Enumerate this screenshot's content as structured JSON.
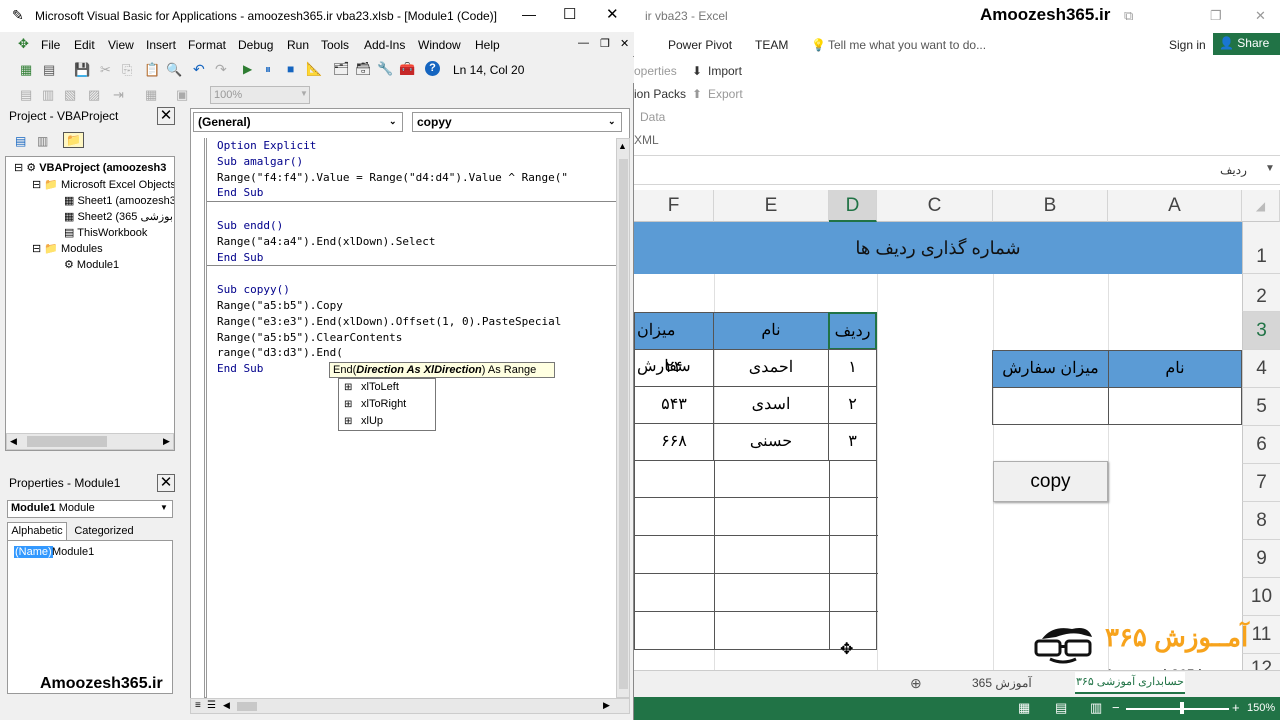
{
  "excel": {
    "title": "ir vba23 - Excel",
    "brand": "Amoozesh365.ir",
    "tabs": [
      "Power Pivot",
      "TEAM"
    ],
    "tell_me": "Tell me what you want to do...",
    "sign_in": "Sign in",
    "share": "Share",
    "ribbon": {
      "properties": "operties",
      "import": "Import",
      "packs": "ion Packs",
      "export": "Export",
      "data": "Data",
      "xml": "XML"
    },
    "name_box": "ردیف",
    "columns": [
      "F",
      "E",
      "D",
      "C",
      "B",
      "A"
    ],
    "rows": [
      "1",
      "2",
      "3",
      "4",
      "5",
      "6",
      "7",
      "8",
      "9",
      "10",
      "11",
      "12"
    ],
    "header_title": "شماره گذاری ردیف ها",
    "table1": {
      "headers": [
        "میزان سفارش",
        "نام",
        "ردیف"
      ],
      "rows": [
        {
          "amount": "۲۴",
          "name": "احمدی",
          "id": "۱"
        },
        {
          "amount": "۵۴۳",
          "name": "اسدی",
          "id": "۲"
        },
        {
          "amount": "۶۶۸",
          "name": "حسنی",
          "id": "۳"
        }
      ]
    },
    "table2": {
      "headers": [
        "میزان سفارش",
        "نام"
      ]
    },
    "copy_button": "copy",
    "sheet_tab": "365 آموزش",
    "sheet_tab_partial": "۳۶۵ حسابداری آموزشی",
    "zoom": "150%",
    "logo_text": "آمــوزش ۳۶۵",
    "logo_url": "Amoozesh365.ir"
  },
  "vba": {
    "title": "Microsoft Visual Basic for Applications - amoozesh365.ir vba23.xlsb - [Module1 (Code)]",
    "menus": [
      "File",
      "Edit",
      "View",
      "Insert",
      "Format",
      "Debug",
      "Run",
      "Tools",
      "Add-Ins",
      "Window",
      "Help"
    ],
    "position": "Ln 14, Col 20",
    "zoom": "100%",
    "project_title": "Project - VBAProject",
    "tree": [
      {
        "label": "VBAProject (amoozesh3",
        "level": 0,
        "bold": true
      },
      {
        "label": "Microsoft Excel Objects",
        "level": 1
      },
      {
        "label": "Sheet1 (amoozesh3",
        "level": 2
      },
      {
        "label": "Sheet2 (365 بوزشی",
        "level": 2
      },
      {
        "label": "ThisWorkbook",
        "level": 2
      },
      {
        "label": "Modules",
        "level": 1
      },
      {
        "label": "Module1",
        "level": 2
      }
    ],
    "properties_title": "Properties - Module1",
    "props_object": "Module1",
    "props_type": "Module",
    "props_tabs": [
      "Alphabetic",
      "Categorized"
    ],
    "props_name_key": "(Name)",
    "props_name_val": "Module1",
    "object_dropdown": "(General)",
    "proc_dropdown": "copyy",
    "code": [
      [
        "kw",
        "Option Explicit"
      ],
      [
        "kw",
        "Sub amalgar()"
      ],
      [
        "",
        "Range(\"f4:f4\").Value = Range(\"d4:d4\").Value ^ Range(\""
      ],
      [
        "kw",
        "End Sub"
      ],
      [
        "sep",
        ""
      ],
      [
        "",
        ""
      ],
      [
        "kw",
        "Sub endd()"
      ],
      [
        "",
        "Range(\"a4:a4\").End(xlDown).Select"
      ],
      [
        "kw",
        "End Sub"
      ],
      [
        "sep",
        ""
      ],
      [
        "",
        ""
      ],
      [
        "kw",
        "Sub copyy()"
      ],
      [
        "",
        "Range(\"a5:b5\").Copy"
      ],
      [
        "",
        "Range(\"e3:e3\").End(xlDown).Offset(1, 0).PasteSpecial"
      ],
      [
        "",
        "Range(\"a5:b5\").ClearContents"
      ],
      [
        "",
        "range(\"d3:d3\").End("
      ],
      [
        "kw",
        "End Sub"
      ]
    ],
    "tooltip": {
      "prefix": "End(",
      "param": "Direction As XlDirection",
      "suffix": ") As Range"
    },
    "autocomplete": [
      "xlToLeft",
      "xlToRight",
      "xlUp"
    ],
    "brand": "Amoozesh365.ir"
  }
}
